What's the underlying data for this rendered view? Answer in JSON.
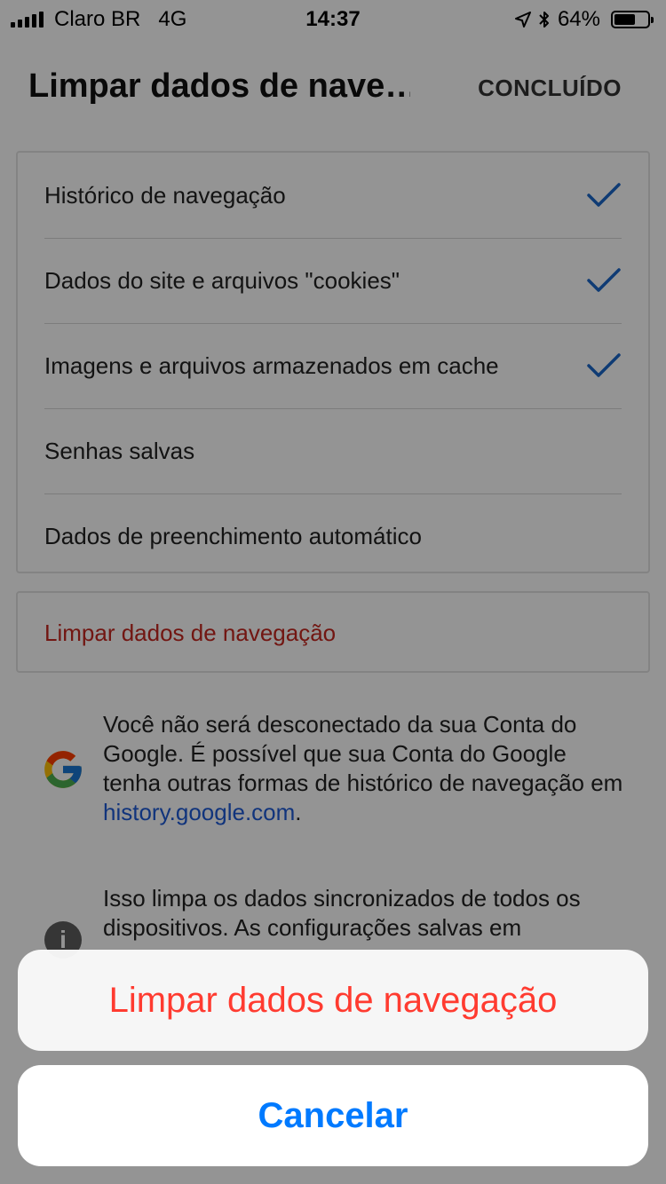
{
  "status_bar": {
    "carrier": "Claro BR",
    "network": "4G",
    "time": "14:37",
    "battery_percent": "64%",
    "battery_level": 0.64
  },
  "header": {
    "title": "Limpar dados de nave…",
    "done_label": "CONCLUÍDO"
  },
  "options": [
    {
      "label": "Histórico de navegação",
      "checked": true
    },
    {
      "label": "Dados do site e arquivos \"cookies\"",
      "checked": true
    },
    {
      "label": "Imagens e arquivos armazenados em cache",
      "checked": true
    },
    {
      "label": "Senhas salvas",
      "checked": false
    },
    {
      "label": "Dados de preenchimento automático",
      "checked": false
    }
  ],
  "clear_card": {
    "label": "Limpar dados de navegação"
  },
  "info_google": {
    "text_before": "Você não será desconectado da sua Conta do Google. É possível que sua Conta do Google tenha outras formas de histórico de navegação em ",
    "link": "history.google.com",
    "text_after": "."
  },
  "info_sync": {
    "text": "Isso limpa os dados sincronizados de todos os dispositivos. As configurações salvas em"
  },
  "action_sheet": {
    "destructive_label": "Limpar dados de navegação",
    "cancel_label": "Cancelar"
  },
  "colors": {
    "accent_check": "#1a66c9",
    "destructive_red": "#ff3b30",
    "ios_blue": "#007aff",
    "link_blue": "#1e5bd6"
  }
}
